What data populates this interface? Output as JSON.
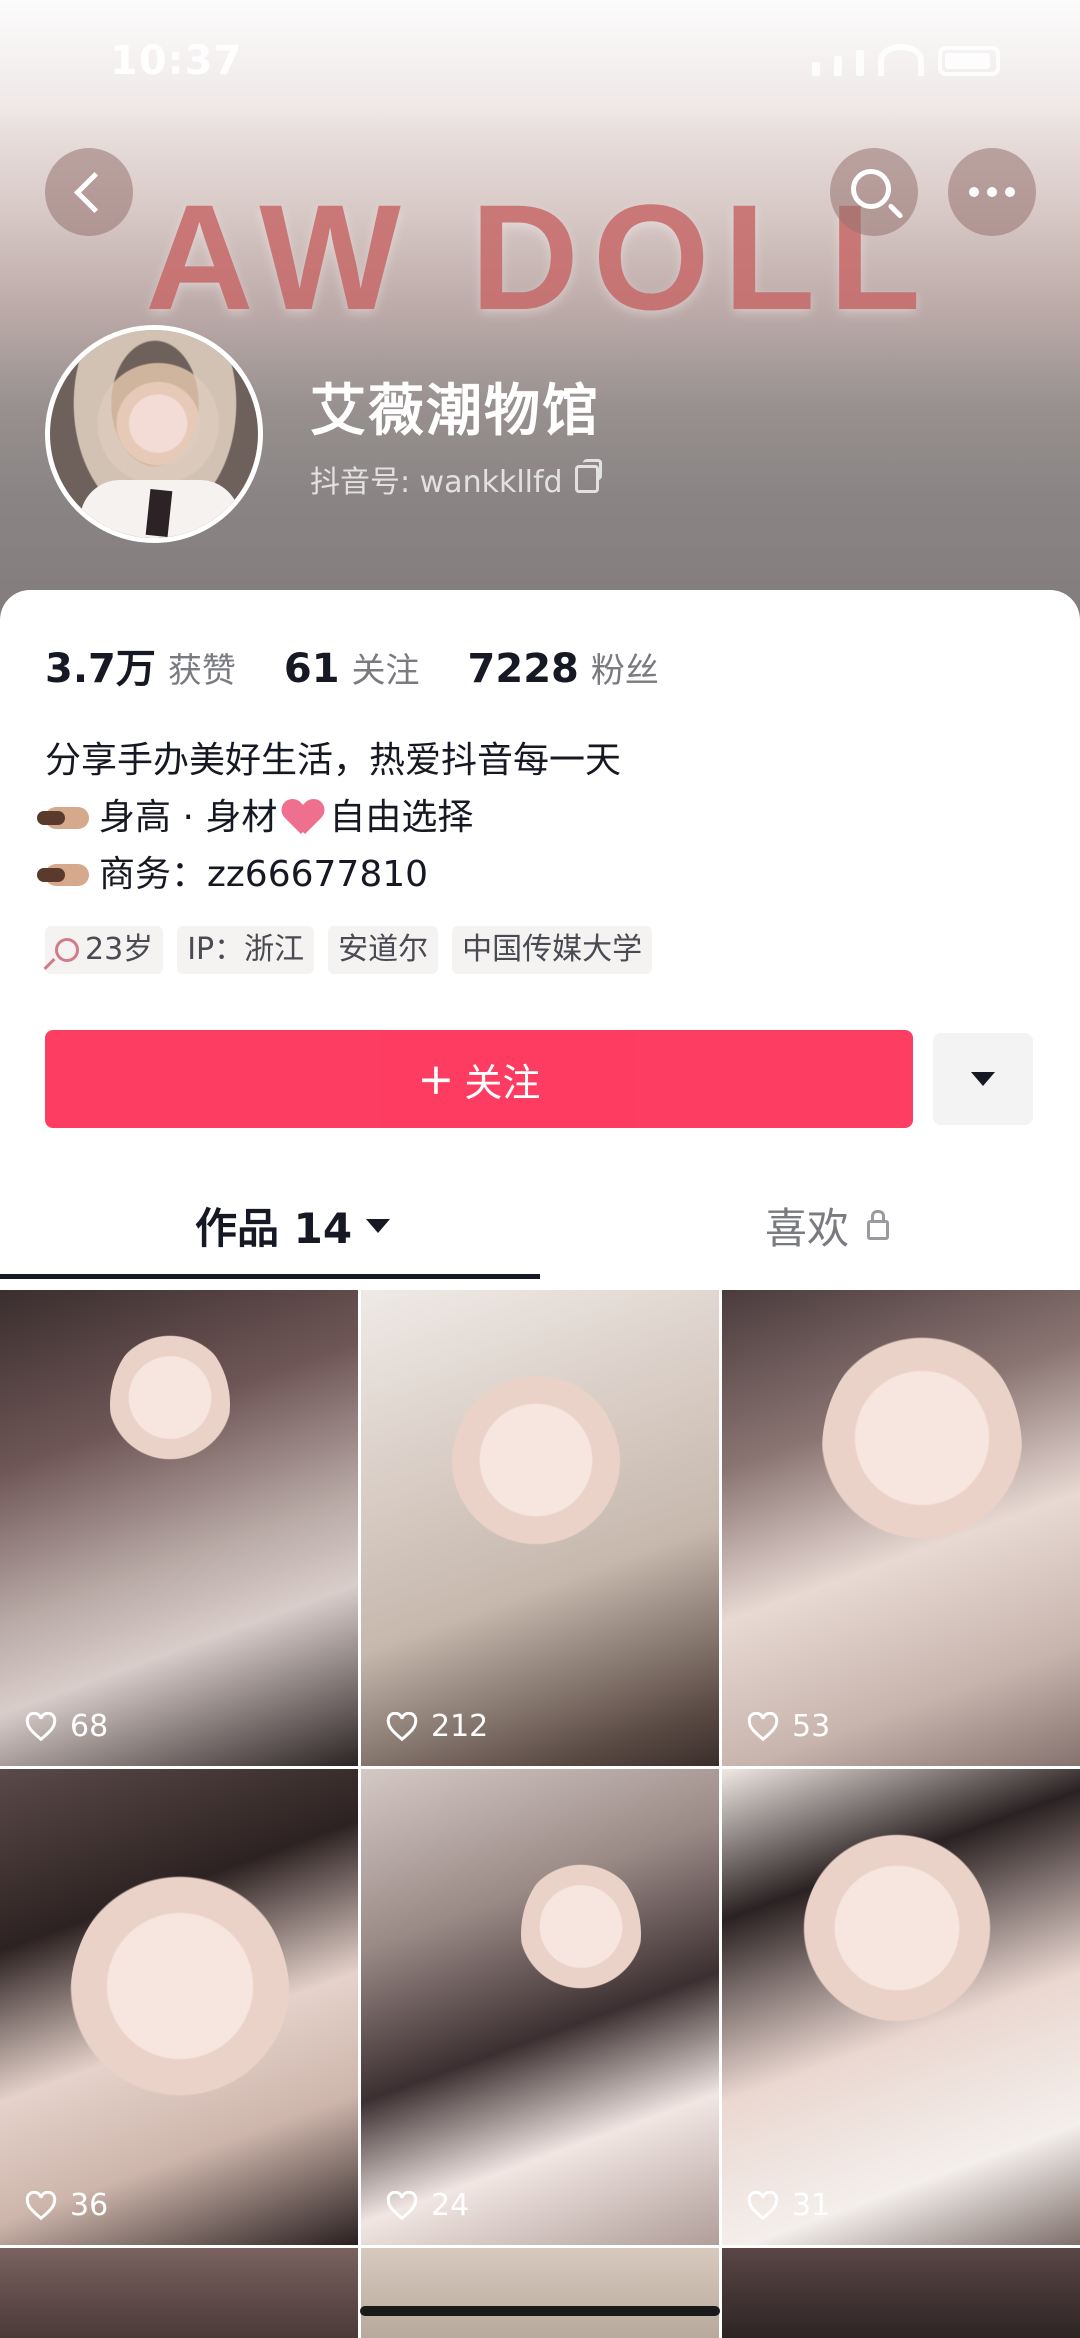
{
  "status_bar": {
    "time": "10:37"
  },
  "header": {
    "banner_text": "AW DOLL",
    "name": "艾薇潮物馆",
    "douyin_id": "抖音号: wankkllfd",
    "back_icon": "chevron-left-icon",
    "search_icon": "search-icon",
    "more_icon": "more-icon"
  },
  "stats": [
    {
      "num": "3.7万",
      "label": "获赞"
    },
    {
      "num": "61",
      "label": "关注"
    },
    {
      "num": "7228",
      "label": "粉丝"
    }
  ],
  "bio": {
    "line1": "分享手办美好生活，热爱抖音每一天",
    "line2a": "身高 · 身材",
    "line2b": "自由选择",
    "line3": "商务：zz66677810"
  },
  "tags": {
    "age": "23岁",
    "ip": "IP：浙江",
    "place": "安道尔",
    "school": "中国传媒大学"
  },
  "actions": {
    "follow": "关注",
    "follow_icon": "+"
  },
  "tabs": {
    "works": "作品 14",
    "likes": "喜欢"
  },
  "videos": [
    {
      "likes": "68"
    },
    {
      "likes": "212"
    },
    {
      "likes": "53"
    },
    {
      "likes": "36"
    },
    {
      "likes": "24"
    },
    {
      "likes": "31"
    }
  ],
  "colors": {
    "follow": "#fe2c55",
    "brand_text": "#c86a6a"
  }
}
